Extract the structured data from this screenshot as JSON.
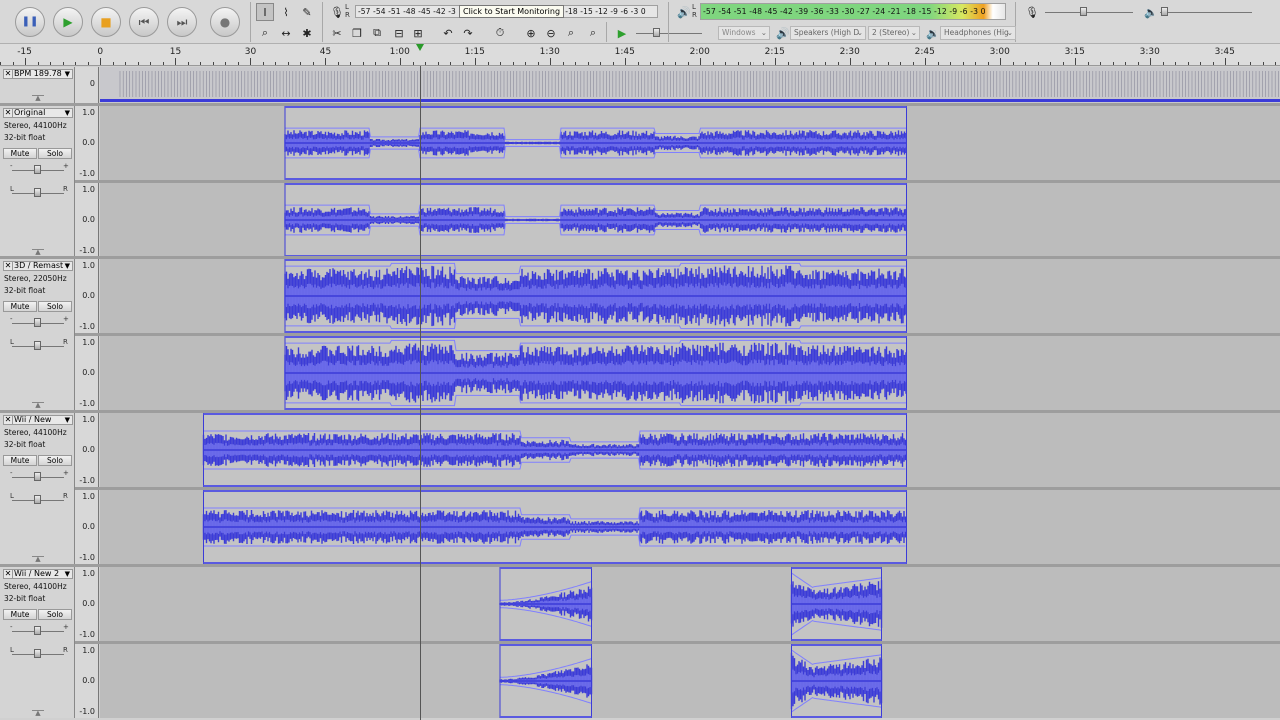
{
  "toolbar": {
    "buttons": {
      "pause": {
        "glyph": "❚❚",
        "color": "#3a5fb8"
      },
      "play": {
        "glyph": "▶",
        "color": "#2ea02e"
      },
      "stop": {
        "glyph": "■",
        "color": "#e8a020"
      },
      "skip_start": {
        "glyph": "⏮",
        "color": "#555555"
      },
      "skip_end": {
        "glyph": "⏭",
        "color": "#555555"
      },
      "record": {
        "glyph": "●",
        "color": "#777777"
      }
    },
    "tools": [
      "I",
      "✎",
      "🔍",
      "↔",
      "✱",
      "⚙"
    ],
    "record_meter_scale": "-57 -54 -51 -48 -45 -42 -3",
    "record_meter_scale_tail": "21 -18 -15 -12 -9 -6 -3 0",
    "monitor_tooltip": "Click to Start Monitoring",
    "playback_meter_scale": "-57 -54 -51 -48 -45 -42 -39 -36 -33 -30 -27 -24 -21 -18 -15 -12 -9 -6 -3 0",
    "edit_tools": [
      "✂",
      "❐",
      "⧉",
      "⊟",
      "⊞",
      "↶",
      "↷"
    ],
    "device": {
      "host": "Windows",
      "output": "Speakers (High D",
      "channels": "2 (Stereo)",
      "input": "Headphones (Hig"
    }
  },
  "ruler": {
    "labels": [
      "-15",
      "0",
      "15",
      "30",
      "45",
      "1:00",
      "1:15",
      "1:30",
      "1:45",
      "2:00",
      "2:15",
      "2:30",
      "2:45",
      "3:00",
      "3:15",
      "3:30",
      "3:45"
    ]
  },
  "bpm_track": {
    "name": "BPM 189.78",
    "scale_zero": "0"
  },
  "tracks": [
    {
      "name": "Original",
      "rate": "Stereo, 44100Hz",
      "format": "32-bit float",
      "mute": "Mute",
      "solo": "Solo",
      "scale": [
        "1.0",
        "0.0",
        "-1.0"
      ],
      "clips": [
        [
          37.0,
          161.3
        ]
      ]
    },
    {
      "name": "3D / Remast",
      "rate": "Stereo, 22050Hz",
      "format": "32-bit float",
      "mute": "Mute",
      "solo": "Solo",
      "scale": [
        "1.0",
        "0.0",
        "-1.0"
      ],
      "clips": [
        [
          37.0,
          161.3
        ]
      ]
    },
    {
      "name": "Wii / New",
      "rate": "Stereo, 44100Hz",
      "format": "32-bit float",
      "mute": "Mute",
      "solo": "Solo",
      "scale": [
        "1.0",
        "0.0",
        "-1.0"
      ],
      "clips": [
        [
          20.7,
          161.3
        ]
      ]
    },
    {
      "name": "Wii / New 2",
      "rate": "Stereo, 44100Hz",
      "format": "32-bit float",
      "mute": "Mute",
      "solo": "Solo",
      "scale": [
        "1.0",
        "0.0",
        "-1.0"
      ],
      "clips": [
        [
          80.0,
          98.3
        ],
        [
          138.3,
          156.3
        ]
      ]
    }
  ],
  "playhead_time": 64.0,
  "colors": {
    "waveform": "#3b3bd8",
    "waveform_light": "#6b6bea",
    "envelope": "#8080ff",
    "lane": "#bcbcbc",
    "clip": "#c4c4c4"
  }
}
